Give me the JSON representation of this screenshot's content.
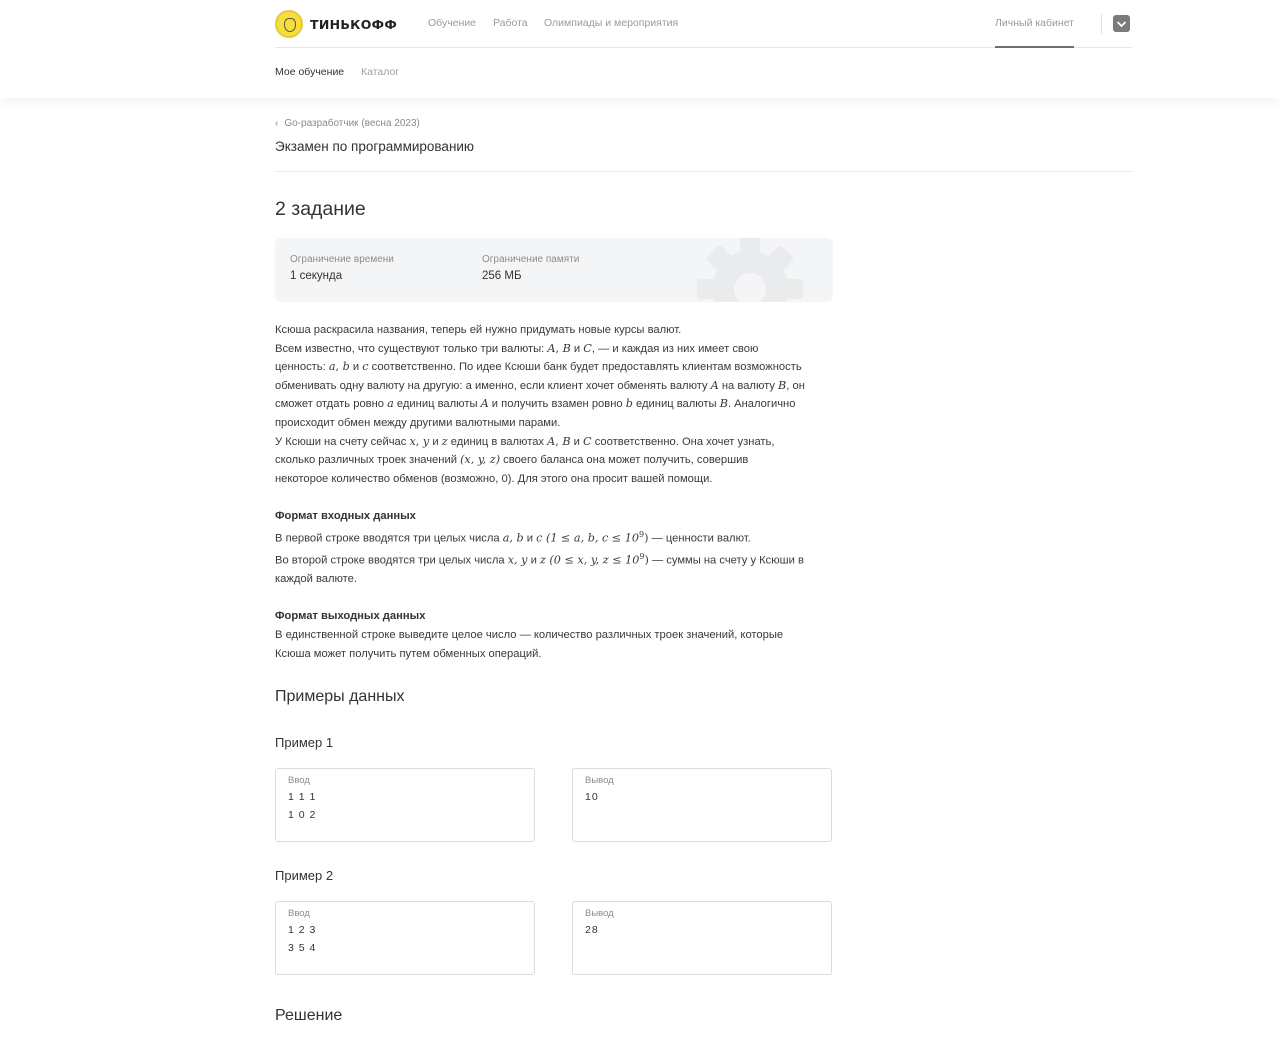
{
  "header": {
    "logo_text": "ТИНЬКОФФ",
    "nav": [
      "Обучение",
      "Работа",
      "Олимпиады и мероприятия"
    ],
    "cabinet": "Личный кабинет",
    "subnav": {
      "active": "Мое обучение",
      "inactive": "Каталог"
    }
  },
  "breadcrumb": {
    "back": "Go-разработчик (весна 2023)"
  },
  "exam_title": "Экзамен по программированию",
  "task": {
    "title": "2 задание",
    "limits": {
      "time_label": "Ограничение времени",
      "time_value": "1 секунда",
      "memory_label": "Ограничение памяти",
      "memory_value": "256 МБ"
    },
    "statement": {
      "l1": "Ксюша раскрасила названия, теперь ей нужно придумать новые курсы валют.",
      "l2a": "Всем известно, что существуют только три валюты: ",
      "m_A": "A",
      "m_B": "B",
      "m_C": "C",
      "comma": ", ",
      "and": " и ",
      "l2b": ", — и каждая из них имеет свою",
      "l3a": "ценность: ",
      "m_a": "a",
      "m_b": "b",
      "m_c": "c",
      "l3b": " соответственно. По идее Ксюши банк будет предоставлять клиентам возможность",
      "l4a": "обменивать одну валюту на другую: а именно, если клиент хочет обменять валюту ",
      "l4b": " на валюту ",
      "l4c": ", он",
      "l5a": "сможет отдать ровно ",
      "l5b": " единиц валюты ",
      "l5c": " и получить взамен ровно ",
      "l5d": " единиц валюты ",
      "l5e": ". Аналогично",
      "l6": "происходит обмен между другими валютными парами.",
      "l7a": "У Ксюши на счету сейчас ",
      "m_x": "x",
      "m_y": "y",
      "m_z": "z",
      "l7b": " единиц в валютах ",
      "l7c": " соответственно. Она хочет узнать,",
      "l8a": "сколько различных троек значений ",
      "m_xyz": "(x, y, z)",
      "l8b": " своего баланса она может получить, совершив",
      "l9": "некоторое количество обменов (возможно, 0). Для этого она просит вашей помощи."
    },
    "input_format": {
      "heading": "Формат входных данных",
      "l1a": "В первой строке вводятся три целых числа ",
      "m1": "a, b",
      "l1b": " и ",
      "m2": "c",
      "m3": " (1 ≤ a, b, c ≤ 10",
      "sup": "9",
      "m_close": ")",
      "l1c": " — ценности валют.",
      "l2a": "Во второй строке вводятся три целых числа ",
      "m4": "x, y",
      "m5": "z",
      "m6": " (0 ≤ x, y, z ≤ 10",
      "l2b": " — суммы на счету у Ксюши в",
      "l3": "каждой валюте."
    },
    "output_format": {
      "heading": "Формат выходных данных",
      "l1": "В единственной строке выведите целое число — количество различных троек значений, которые",
      "l2": "Ксюша может получить путем обменных операций."
    }
  },
  "examples": {
    "section_title": "Примеры данных",
    "items": [
      {
        "title": "Пример 1",
        "input_label": "Ввод",
        "input_lines": [
          "1 1 1",
          "1 0 2"
        ],
        "output_label": "Вывод",
        "output_lines": [
          "10"
        ]
      },
      {
        "title": "Пример 2",
        "input_label": "Ввод",
        "input_lines": [
          "1 2 3",
          "3 5 4"
        ],
        "output_label": "Вывод",
        "output_lines": [
          "28"
        ]
      }
    ]
  },
  "solution_title": "Решение",
  "colors": {
    "logo_yellow": "#f7de3b",
    "text": "#333333",
    "muted": "#9a9a9a",
    "limits_bg": "#f4f5f6"
  },
  "icons": {
    "user_menu": "chevron-down-icon",
    "back": "chevron-left-icon",
    "decor": "gear-icon"
  }
}
